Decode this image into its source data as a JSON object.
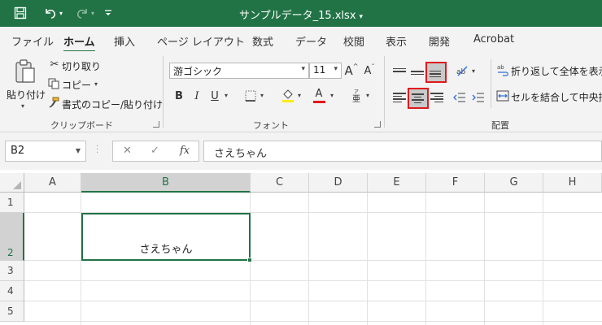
{
  "titlebar": {
    "filename": "サンプルデータ_15.xlsx",
    "caret": "▾",
    "save_icon": "save-icon",
    "undo_icon": "undo-icon",
    "redo_icon": "redo-icon",
    "customize_icon": "customize-quick-access-icon"
  },
  "tabs": [
    "ファイル",
    "ホーム",
    "挿入",
    "ページ レイアウト",
    "数式",
    "データ",
    "校閲",
    "表示",
    "開発",
    "Acrobat"
  ],
  "active_tab": "ホーム",
  "clipboard": {
    "paste_label": "貼り付け",
    "cut_label": "切り取り",
    "copy_label": "コピー",
    "format_painter_label": "書式のコピー/貼り付け",
    "group_label": "クリップボード"
  },
  "font": {
    "name": "游ゴシック",
    "size": "11",
    "grow_label": "A",
    "shrink_label": "A",
    "bold": "B",
    "italic": "I",
    "underline": "U",
    "font_color_label": "A",
    "phonetic_label": "亜",
    "group_label": "フォント",
    "font_color": "#e0191c",
    "fill_color": "#ffeb00"
  },
  "alignment": {
    "wrap_label": "折り返して全体を表示す",
    "merge_label": "セルを結合して中央揃え",
    "group_label": "配置",
    "highlight_color": "#e0191c"
  },
  "formula_bar": {
    "name_box": "B2",
    "cancel": "✕",
    "enter": "✓",
    "fx": "fx",
    "value": "さえちゃん"
  },
  "grid": {
    "columns": [
      "A",
      "B",
      "C",
      "D",
      "E",
      "F",
      "G",
      "H"
    ],
    "rows": [
      "1",
      "2",
      "3",
      "4",
      "5"
    ],
    "selected_column": "B",
    "selected_row": "2",
    "cells": {
      "B2": "さえちゃん"
    }
  }
}
